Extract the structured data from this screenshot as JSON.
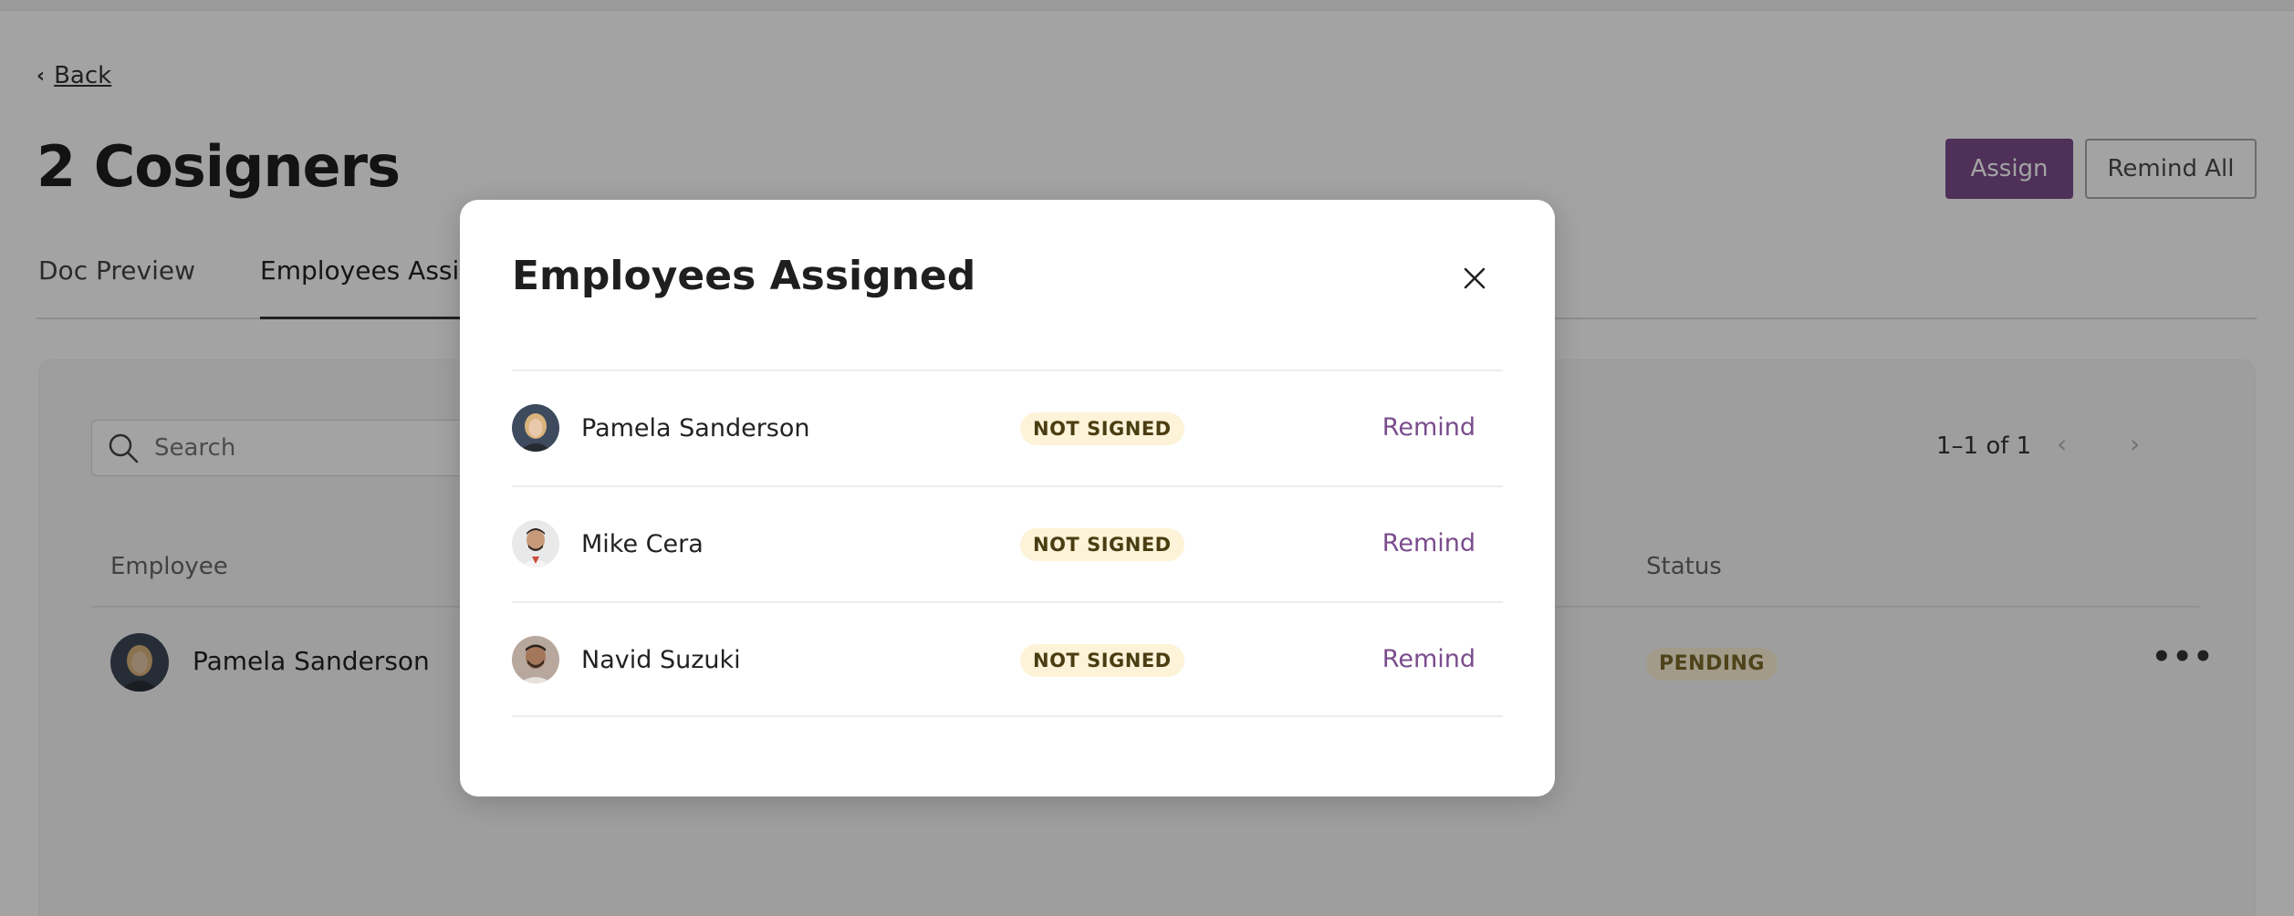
{
  "back": {
    "label": "Back"
  },
  "page": {
    "title": "2 Cosigners"
  },
  "actions": {
    "assign_label": "Assign",
    "remind_all_label": "Remind All"
  },
  "tabs": [
    {
      "label": "Doc Preview"
    },
    {
      "label": "Employees Assigned"
    }
  ],
  "table": {
    "search": {
      "placeholder": "Search",
      "value": ""
    },
    "pagination": {
      "text": "1–1 of 1"
    },
    "columns": {
      "employee": "Employee",
      "status": "Status"
    },
    "rows": [
      {
        "name": "Pamela Sanderson",
        "status": "PENDING"
      }
    ]
  },
  "modal": {
    "title": "Employees Assigned",
    "items": [
      {
        "name": "Pamela Sanderson",
        "status": "NOT SIGNED",
        "action": "Remind"
      },
      {
        "name": "Mike Cera",
        "status": "NOT SIGNED",
        "action": "Remind"
      },
      {
        "name": "Navid Suzuki",
        "status": "NOT SIGNED",
        "action": "Remind"
      }
    ]
  },
  "colors": {
    "accent": "#7a4c8c",
    "badge_bg": "#fdf3d8",
    "overlay": "rgba(0,0,0,0.36)"
  },
  "icons": {
    "back": "chevron-left-icon",
    "search": "search-icon",
    "close": "close-icon",
    "prev": "chevron-left-icon",
    "next": "chevron-right-icon",
    "more": "more-horizontal-icon"
  }
}
